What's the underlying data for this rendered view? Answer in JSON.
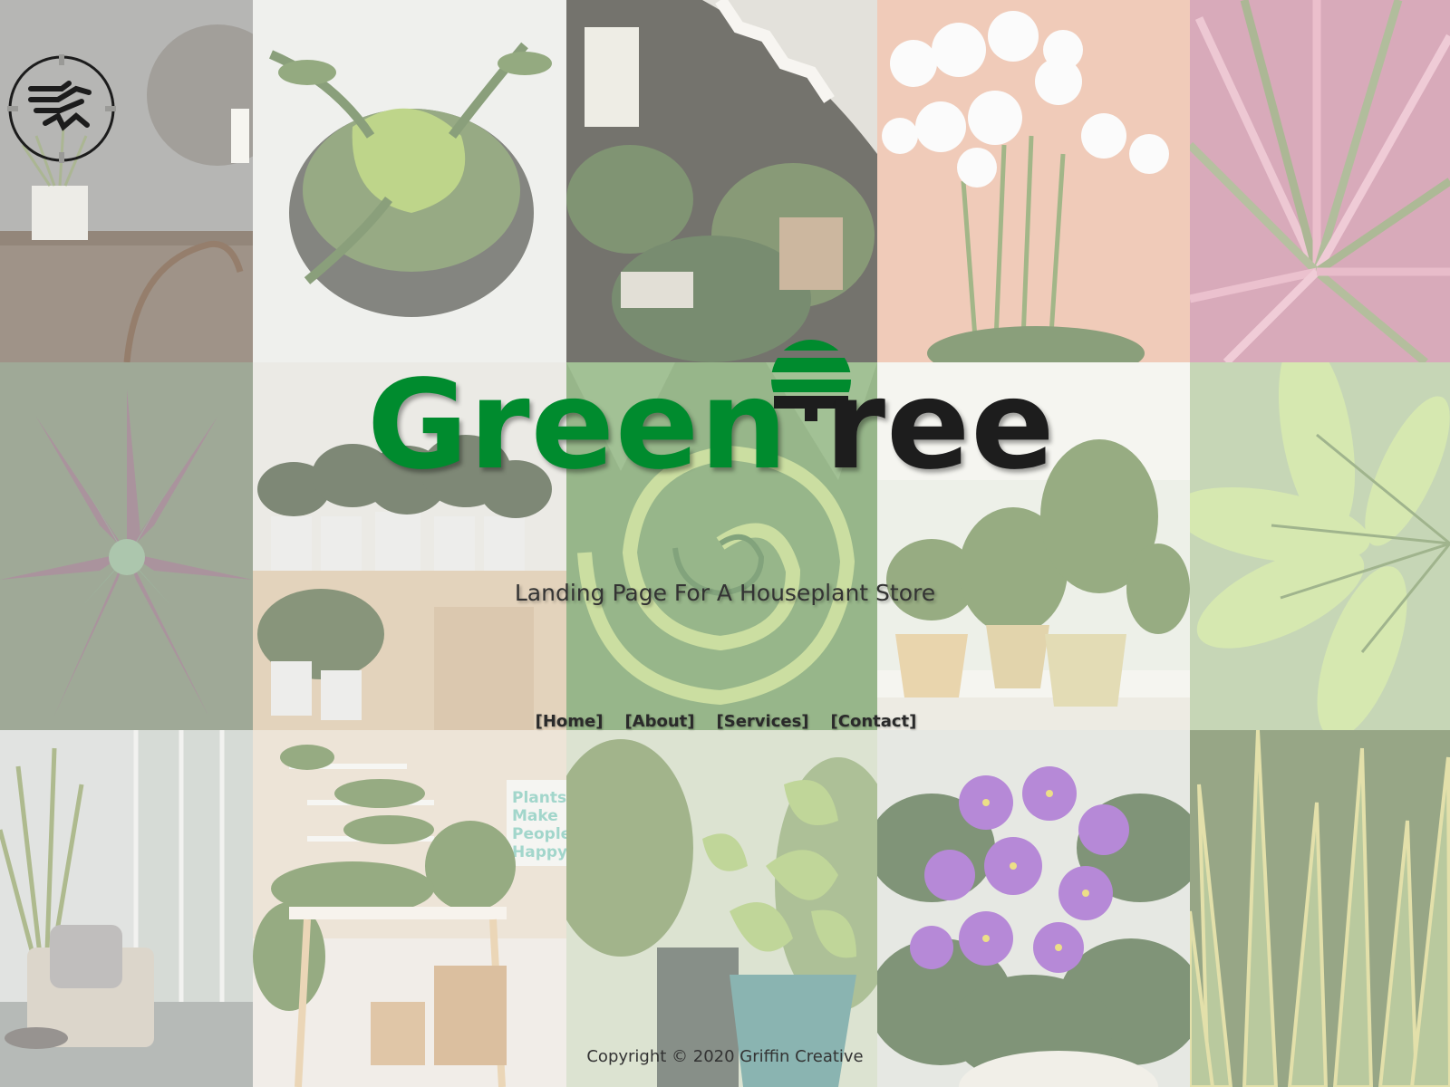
{
  "brand": {
    "name_green": "Green",
    "name_dark": "ree",
    "tagline": "Landing Page For A Houseplant Store"
  },
  "nav": {
    "items": [
      {
        "label": "[Home]"
      },
      {
        "label": "[About]"
      },
      {
        "label": "[Services]"
      },
      {
        "label": "[Contact]"
      }
    ]
  },
  "footer": {
    "copyright": "Copyright © 2020 Griffin Creative"
  },
  "tiles": {
    "shop_sign": "Plants Make People Happy"
  },
  "colors": {
    "brand_green": "#008b2e",
    "brand_dark": "#1d1d1d",
    "text": "#333333"
  },
  "icons": {
    "logo": "griffin-circle-logo",
    "brand_glyph": "tree-icon"
  }
}
